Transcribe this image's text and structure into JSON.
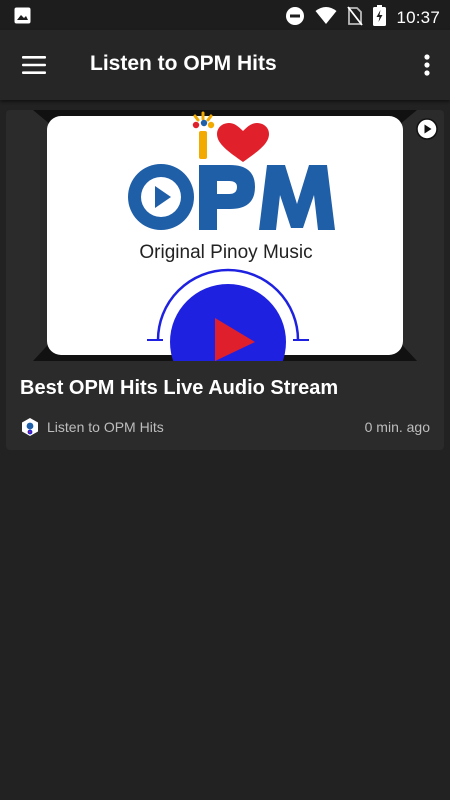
{
  "status_bar": {
    "time": "10:37",
    "icons": [
      "image-icon",
      "do-not-disturb-icon",
      "wifi-icon",
      "no-sim-icon",
      "battery-charging-icon"
    ]
  },
  "toolbar": {
    "title": "Listen to OPM Hits",
    "menu_icon": "hamburger-menu-icon",
    "overflow_icon": "more-vert-icon"
  },
  "card": {
    "title": "Best OPM Hits Live Audio Stream",
    "source": "Listen to OPM Hits",
    "time_ago": "0 min. ago",
    "thumbnail": {
      "logo_line1": "i",
      "logo_main": "OPM",
      "logo_tagline": "Original Pinoy Music"
    }
  },
  "colors": {
    "background": "#222222",
    "toolbar": "#262626",
    "card": "#2b2b2b",
    "logo_blue": "#1f5fa8",
    "play_blue": "#1e22e0",
    "play_red": "#e01f2d",
    "heart_red": "#e0202a"
  }
}
